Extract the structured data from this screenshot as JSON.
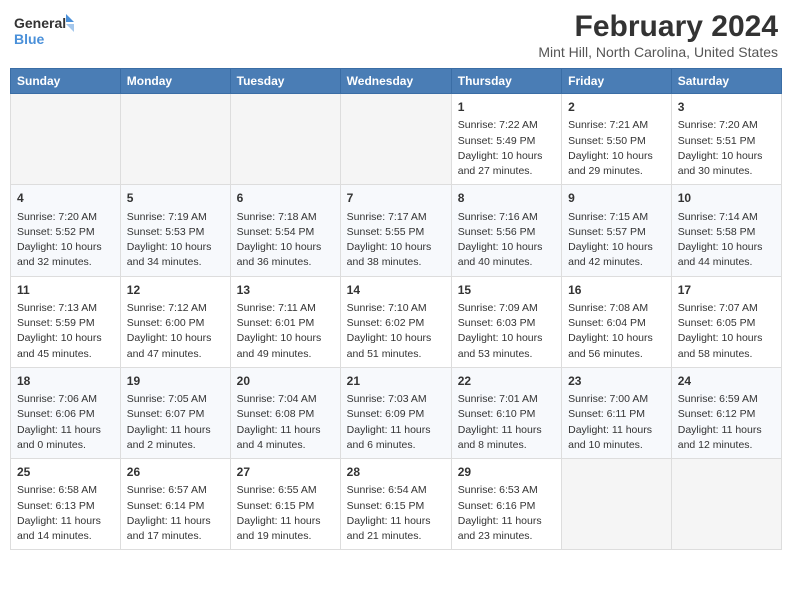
{
  "header": {
    "logo_line1": "General",
    "logo_line2": "Blue",
    "title": "February 2024",
    "subtitle": "Mint Hill, North Carolina, United States"
  },
  "days_of_week": [
    "Sunday",
    "Monday",
    "Tuesday",
    "Wednesday",
    "Thursday",
    "Friday",
    "Saturday"
  ],
  "weeks": [
    [
      {
        "num": "",
        "info": ""
      },
      {
        "num": "",
        "info": ""
      },
      {
        "num": "",
        "info": ""
      },
      {
        "num": "",
        "info": ""
      },
      {
        "num": "1",
        "info": "Sunrise: 7:22 AM\nSunset: 5:49 PM\nDaylight: 10 hours\nand 27 minutes."
      },
      {
        "num": "2",
        "info": "Sunrise: 7:21 AM\nSunset: 5:50 PM\nDaylight: 10 hours\nand 29 minutes."
      },
      {
        "num": "3",
        "info": "Sunrise: 7:20 AM\nSunset: 5:51 PM\nDaylight: 10 hours\nand 30 minutes."
      }
    ],
    [
      {
        "num": "4",
        "info": "Sunrise: 7:20 AM\nSunset: 5:52 PM\nDaylight: 10 hours\nand 32 minutes."
      },
      {
        "num": "5",
        "info": "Sunrise: 7:19 AM\nSunset: 5:53 PM\nDaylight: 10 hours\nand 34 minutes."
      },
      {
        "num": "6",
        "info": "Sunrise: 7:18 AM\nSunset: 5:54 PM\nDaylight: 10 hours\nand 36 minutes."
      },
      {
        "num": "7",
        "info": "Sunrise: 7:17 AM\nSunset: 5:55 PM\nDaylight: 10 hours\nand 38 minutes."
      },
      {
        "num": "8",
        "info": "Sunrise: 7:16 AM\nSunset: 5:56 PM\nDaylight: 10 hours\nand 40 minutes."
      },
      {
        "num": "9",
        "info": "Sunrise: 7:15 AM\nSunset: 5:57 PM\nDaylight: 10 hours\nand 42 minutes."
      },
      {
        "num": "10",
        "info": "Sunrise: 7:14 AM\nSunset: 5:58 PM\nDaylight: 10 hours\nand 44 minutes."
      }
    ],
    [
      {
        "num": "11",
        "info": "Sunrise: 7:13 AM\nSunset: 5:59 PM\nDaylight: 10 hours\nand 45 minutes."
      },
      {
        "num": "12",
        "info": "Sunrise: 7:12 AM\nSunset: 6:00 PM\nDaylight: 10 hours\nand 47 minutes."
      },
      {
        "num": "13",
        "info": "Sunrise: 7:11 AM\nSunset: 6:01 PM\nDaylight: 10 hours\nand 49 minutes."
      },
      {
        "num": "14",
        "info": "Sunrise: 7:10 AM\nSunset: 6:02 PM\nDaylight: 10 hours\nand 51 minutes."
      },
      {
        "num": "15",
        "info": "Sunrise: 7:09 AM\nSunset: 6:03 PM\nDaylight: 10 hours\nand 53 minutes."
      },
      {
        "num": "16",
        "info": "Sunrise: 7:08 AM\nSunset: 6:04 PM\nDaylight: 10 hours\nand 56 minutes."
      },
      {
        "num": "17",
        "info": "Sunrise: 7:07 AM\nSunset: 6:05 PM\nDaylight: 10 hours\nand 58 minutes."
      }
    ],
    [
      {
        "num": "18",
        "info": "Sunrise: 7:06 AM\nSunset: 6:06 PM\nDaylight: 11 hours\nand 0 minutes."
      },
      {
        "num": "19",
        "info": "Sunrise: 7:05 AM\nSunset: 6:07 PM\nDaylight: 11 hours\nand 2 minutes."
      },
      {
        "num": "20",
        "info": "Sunrise: 7:04 AM\nSunset: 6:08 PM\nDaylight: 11 hours\nand 4 minutes."
      },
      {
        "num": "21",
        "info": "Sunrise: 7:03 AM\nSunset: 6:09 PM\nDaylight: 11 hours\nand 6 minutes."
      },
      {
        "num": "22",
        "info": "Sunrise: 7:01 AM\nSunset: 6:10 PM\nDaylight: 11 hours\nand 8 minutes."
      },
      {
        "num": "23",
        "info": "Sunrise: 7:00 AM\nSunset: 6:11 PM\nDaylight: 11 hours\nand 10 minutes."
      },
      {
        "num": "24",
        "info": "Sunrise: 6:59 AM\nSunset: 6:12 PM\nDaylight: 11 hours\nand 12 minutes."
      }
    ],
    [
      {
        "num": "25",
        "info": "Sunrise: 6:58 AM\nSunset: 6:13 PM\nDaylight: 11 hours\nand 14 minutes."
      },
      {
        "num": "26",
        "info": "Sunrise: 6:57 AM\nSunset: 6:14 PM\nDaylight: 11 hours\nand 17 minutes."
      },
      {
        "num": "27",
        "info": "Sunrise: 6:55 AM\nSunset: 6:15 PM\nDaylight: 11 hours\nand 19 minutes."
      },
      {
        "num": "28",
        "info": "Sunrise: 6:54 AM\nSunset: 6:15 PM\nDaylight: 11 hours\nand 21 minutes."
      },
      {
        "num": "29",
        "info": "Sunrise: 6:53 AM\nSunset: 6:16 PM\nDaylight: 11 hours\nand 23 minutes."
      },
      {
        "num": "",
        "info": ""
      },
      {
        "num": "",
        "info": ""
      }
    ]
  ]
}
